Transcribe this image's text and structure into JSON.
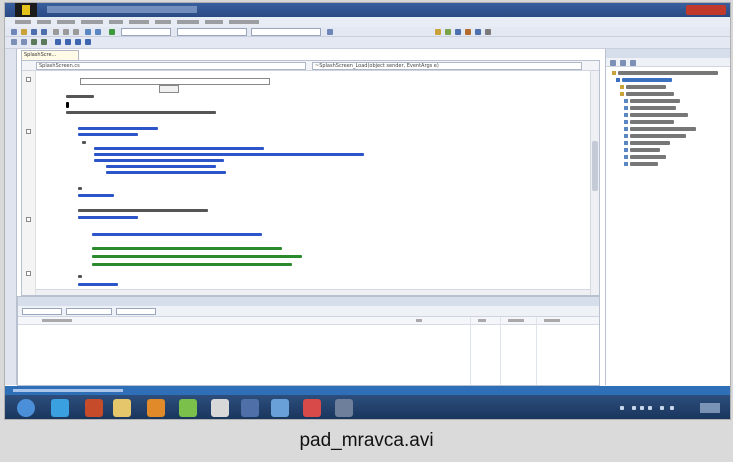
{
  "editor": {
    "doc_tab_label": "SplashScre...",
    "nav_left": "SplashScreen.cs",
    "nav_right": "~SplashScreen_Load(object sender, EventArgs e)"
  },
  "caption": {
    "file_name": "pad_mravca.avi"
  },
  "colors": {
    "title_bar": "#2a4a84",
    "taskbar": "#17335a",
    "status_bar": "#2f6fb8",
    "code_blue": "#2b55c9",
    "code_green": "#2b8a2b",
    "code_red": "#a31515"
  }
}
